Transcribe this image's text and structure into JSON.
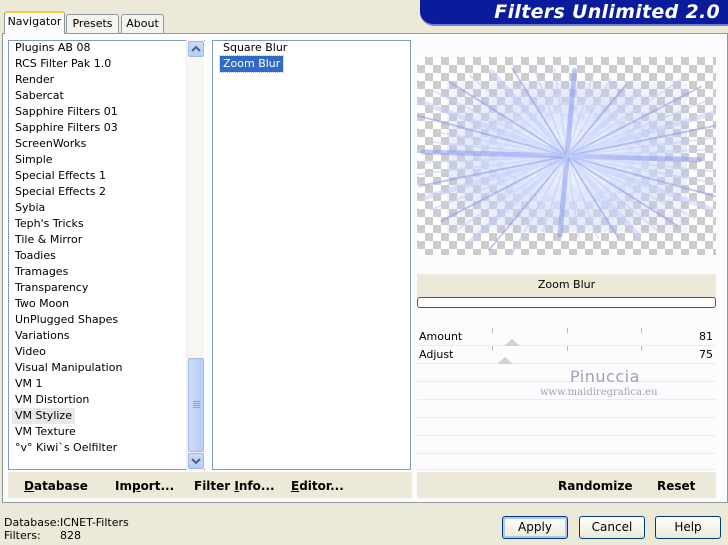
{
  "tabs": [
    {
      "label": "Navigator",
      "active": true
    },
    {
      "label": "Presets",
      "active": false
    },
    {
      "label": "About",
      "active": false
    }
  ],
  "app_title": "Filters Unlimited 2.0",
  "categories": [
    "Plugins AB 08",
    "RCS Filter Pak 1.0",
    "Render",
    "Sabercat",
    "Sapphire Filters 01",
    "Sapphire Filters 03",
    "ScreenWorks",
    "Simple",
    "Special Effects 1",
    "Special Effects 2",
    "Sybia",
    "Teph's Tricks",
    "Tile & Mirror",
    "Toadies",
    "Tramages",
    "Transparency",
    "Two Moon",
    "UnPlugged Shapes",
    "Variations",
    "Video",
    "Visual Manipulation",
    "VM 1",
    "VM Distortion",
    "VM Stylize",
    "VM Texture",
    "°v° Kiwi`s Oelfilter"
  ],
  "selected_category": "VM Stylize",
  "filters": [
    "Square Blur",
    "Zoom Blur"
  ],
  "selected_filter": "Zoom Blur",
  "preview": {
    "filter_name": "Zoom Blur",
    "progress": 0
  },
  "parameters": [
    {
      "label": "Amount",
      "value": "81",
      "level": 81
    },
    {
      "label": "Adjust",
      "value": "75",
      "level": 75
    }
  ],
  "watermark": {
    "name": "Pinuccia",
    "url": "www.maidiregrafica.eu"
  },
  "actions": {
    "database": {
      "label": "Database",
      "underline": "D",
      "rest": "atabase"
    },
    "import": {
      "pre": "Im",
      "underline": "p",
      "rest": "ort..."
    },
    "filter_info": {
      "pre": "Filter ",
      "underline": "I",
      "rest": "nfo..."
    },
    "editor": {
      "pre": "",
      "underline": "E",
      "rest": "ditor..."
    },
    "randomize": "Randomize",
    "reset": "Reset"
  },
  "status": {
    "database_label": "Database:",
    "database_value": "ICNET-Filters",
    "filters_label": "Filters:",
    "filters_value": "828"
  },
  "buttons": {
    "apply": "Apply",
    "cancel": "Cancel",
    "help": "Help"
  },
  "colors": {
    "banner": "#0a1c9c",
    "selection": "#316ac5"
  }
}
